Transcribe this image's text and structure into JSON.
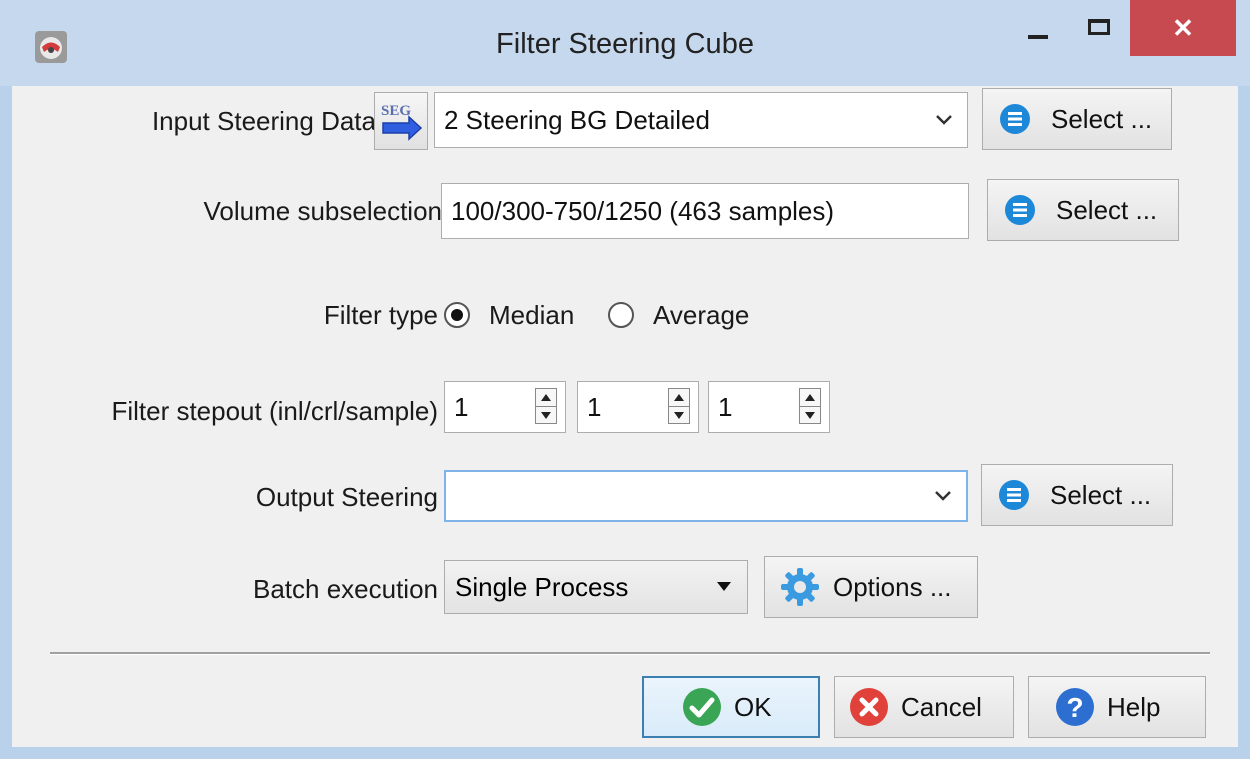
{
  "window": {
    "title": "Filter Steering Cube",
    "close_glyph": "✕"
  },
  "input_steering": {
    "label": "Input Steering Data",
    "value": "2 Steering BG Detailed",
    "select_label": "Select ...",
    "seg_text": "SEG"
  },
  "volume": {
    "label": "Volume subselection",
    "value": "100/300-750/1250 (463 samples)",
    "select_label": "Select ..."
  },
  "filter_type": {
    "label": "Filter type",
    "options": [
      "Median",
      "Average"
    ],
    "selected": "Median"
  },
  "stepout": {
    "label": "Filter stepout (inl/crl/sample)",
    "values": [
      "1",
      "1",
      "1"
    ]
  },
  "output_steering": {
    "label": "Output Steering",
    "value": "",
    "select_label": "Select ..."
  },
  "batch": {
    "label": "Batch execution",
    "value": "Single Process",
    "options_label": "Options ..."
  },
  "footer": {
    "ok_label": "OK",
    "cancel_label": "Cancel",
    "help_label": "Help"
  },
  "colors": {
    "accent_blue": "#1e88d8",
    "ok_green": "#3aa655",
    "cancel_red": "#e0413a",
    "help_blue": "#2c6fd1",
    "close_red": "#c74a50"
  }
}
